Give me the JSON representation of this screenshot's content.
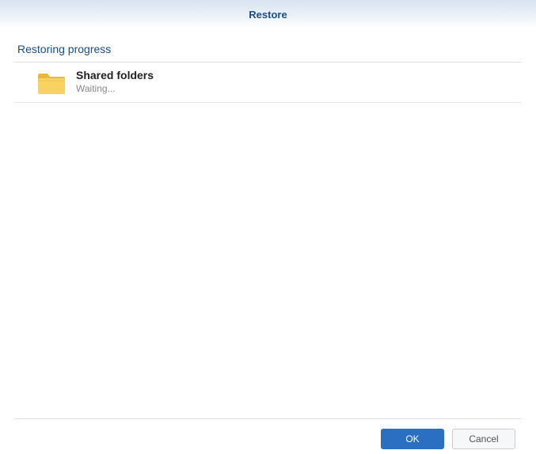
{
  "window": {
    "title": "Restore"
  },
  "section": {
    "heading": "Restoring progress"
  },
  "items": [
    {
      "title": "Shared folders",
      "status": "Waiting..."
    }
  ],
  "buttons": {
    "ok": "OK",
    "cancel": "Cancel"
  }
}
